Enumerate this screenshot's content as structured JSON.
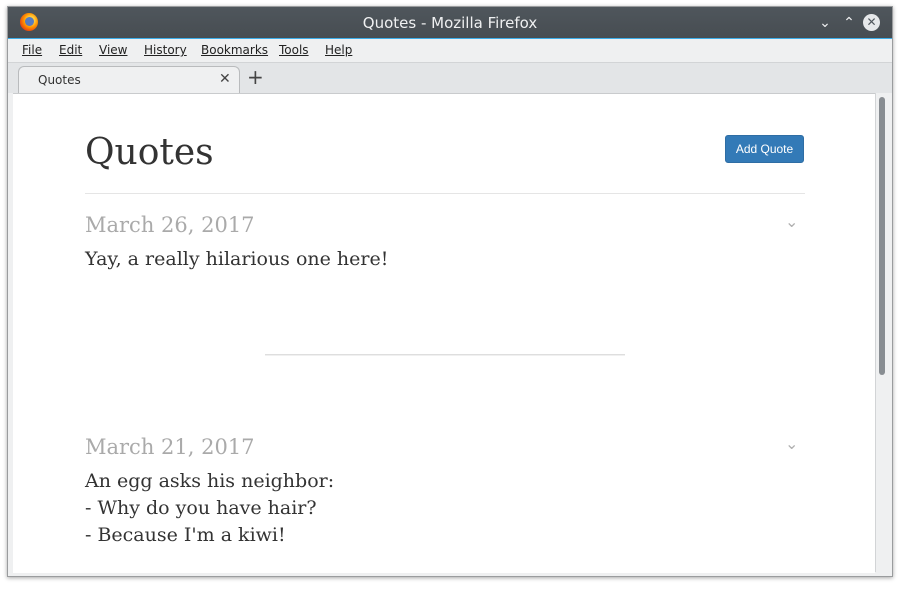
{
  "window": {
    "title": "Quotes - Mozilla Firefox"
  },
  "menu": {
    "items": [
      "File",
      "Edit",
      "View",
      "History",
      "Bookmarks",
      "Tools",
      "Help"
    ]
  },
  "tabs": [
    {
      "label": "Quotes"
    }
  ],
  "page": {
    "title": "Quotes",
    "add_button_label": "Add Quote",
    "quotes": [
      {
        "date": "March 26, 2017",
        "lines": [
          "Yay, a really hilarious one here!"
        ]
      },
      {
        "date": "March 21, 2017",
        "lines": [
          "An egg asks his neighbor:",
          "- Why do you have hair?",
          "- Because I'm a kiwi!"
        ]
      }
    ]
  },
  "icons": {
    "app": "firefox-logo-icon",
    "minimize": "chevron-down-icon",
    "maximize": "chevron-up-icon",
    "close": "close-icon",
    "tab_close": "close-icon",
    "new_tab": "plus-icon",
    "quote_expand": "chevron-down-icon"
  },
  "colors": {
    "accent": "#337ab7",
    "titlebar": "#4f565c",
    "date_text": "#aaaaaa"
  }
}
